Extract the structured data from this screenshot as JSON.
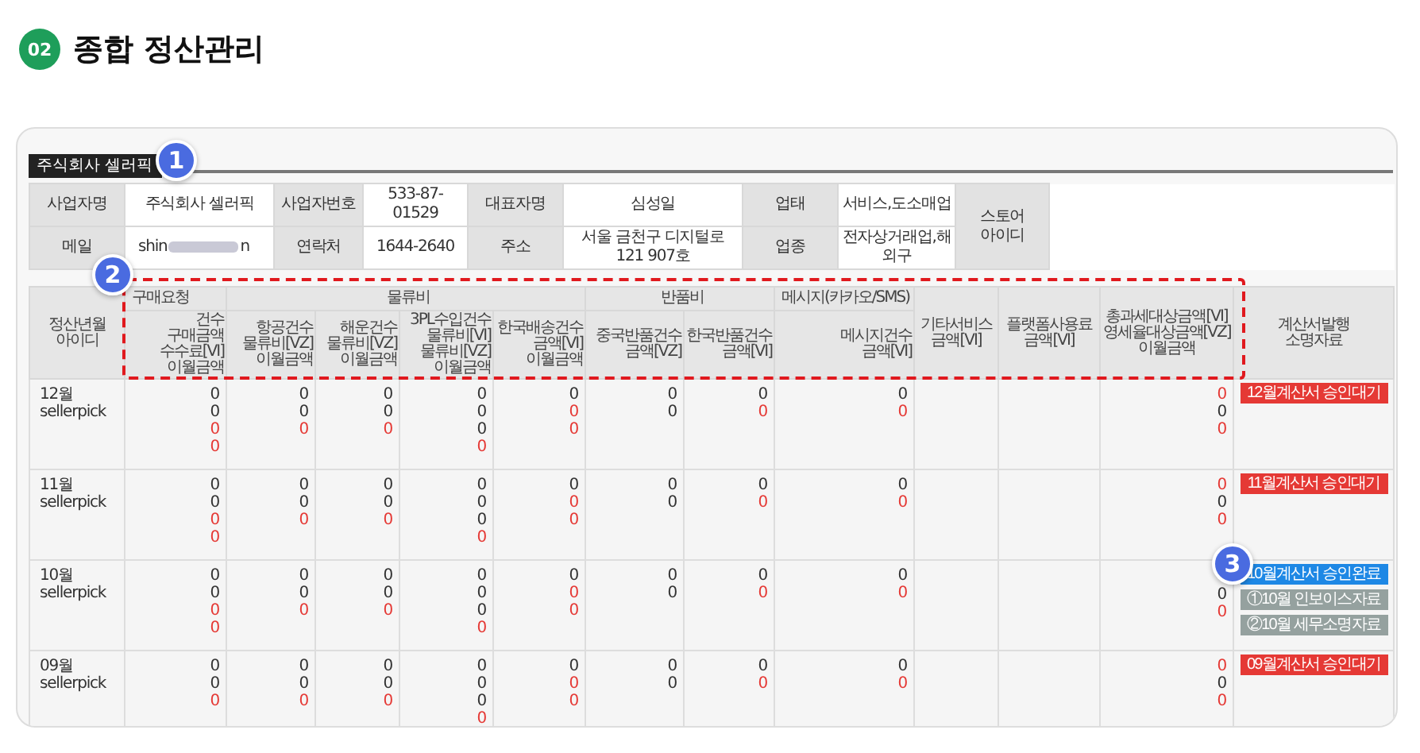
{
  "heading": {
    "number": "02",
    "title": "종합 정산관리"
  },
  "company_tab": "주식회사 셀러픽",
  "info": {
    "row1": [
      {
        "kind": "label",
        "text": "사업자명"
      },
      {
        "kind": "value",
        "text": "주식회사 셀러픽"
      },
      {
        "kind": "label",
        "text": "사업자번호"
      },
      {
        "kind": "value",
        "text": "533-87-01529"
      },
      {
        "kind": "label",
        "text": "대표자명"
      },
      {
        "kind": "value",
        "text": "심성일"
      },
      {
        "kind": "label",
        "text": "업태"
      },
      {
        "kind": "value",
        "text": "서비스,도소매업"
      }
    ],
    "row2": [
      {
        "kind": "label",
        "text": "메일"
      },
      {
        "kind": "redacted",
        "prefix": "shin",
        "suffix": "n"
      },
      {
        "kind": "label",
        "text": "연락처"
      },
      {
        "kind": "value",
        "text": "1644-2640"
      },
      {
        "kind": "label",
        "text": "주소"
      },
      {
        "kind": "value",
        "text": "서울 금천구 디지털로 121 907호"
      },
      {
        "kind": "label",
        "text": "업종"
      },
      {
        "kind": "value",
        "text": "전자상거래업,해외구"
      }
    ],
    "store_label": "스토어\n아이디"
  },
  "headers": [
    {
      "kind": "rowhead",
      "text": "정산년월\n아이디"
    },
    {
      "kind": "group",
      "text": "구매요청",
      "subs": [
        "건수\n구매금액\n수수료[VI]\n이월금액"
      ]
    },
    {
      "kind": "group",
      "text": "물류비",
      "subs": [
        "항공건수\n물류비[VZ]\n이월금액",
        "해운건수\n물류비[VZ]\n이월금액",
        "3PL수입건수\n물류비[VI]\n물류비[VZ]\n이월금액",
        "한국배송건수\n금액[VI]\n이월금액"
      ]
    },
    {
      "kind": "group",
      "text": "반품비",
      "subs": [
        "중국반품건수\n금액[VZ]",
        "한국반품건수\n금액[VI]"
      ]
    },
    {
      "kind": "group",
      "text": "메시지(카카오/SMS)",
      "subs": [
        "메시지건수\n금액[VI]"
      ]
    },
    {
      "kind": "single",
      "text": "기타서비스\n금액[VI]"
    },
    {
      "kind": "single",
      "text": "플랫폼사용료\n금액[VI]"
    },
    {
      "kind": "single",
      "text": "총과세대상금액[VI]\n영세율대상금액[VZ]\n이월금액"
    },
    {
      "kind": "single",
      "text": "계산서발행\n소명자료"
    }
  ],
  "rows": [
    {
      "month": "12월",
      "id": "sellerpick",
      "cells": [
        {
          "kind": "values",
          "lines": [
            {
              "text": "0",
              "emphasized": false
            },
            {
              "text": "0",
              "emphasized": false
            },
            {
              "text": "0",
              "emphasized": true
            },
            {
              "text": "0",
              "emphasized": true
            }
          ]
        },
        {
          "kind": "values",
          "lines": [
            {
              "text": "0",
              "emphasized": false
            },
            {
              "text": "0",
              "emphasized": false
            },
            {
              "text": "0",
              "emphasized": true
            }
          ]
        },
        {
          "kind": "values",
          "lines": [
            {
              "text": "0",
              "emphasized": false
            },
            {
              "text": "0",
              "emphasized": false
            },
            {
              "text": "0",
              "emphasized": true
            }
          ]
        },
        {
          "kind": "values",
          "lines": [
            {
              "text": "0",
              "emphasized": false
            },
            {
              "text": "0",
              "emphasized": false
            },
            {
              "text": "0",
              "emphasized": false
            },
            {
              "text": "0",
              "emphasized": true
            }
          ]
        },
        {
          "kind": "values",
          "lines": [
            {
              "text": "0",
              "emphasized": false
            },
            {
              "text": "0",
              "emphasized": true
            },
            {
              "text": "0",
              "emphasized": true
            }
          ]
        },
        {
          "kind": "values",
          "lines": [
            {
              "text": "0",
              "emphasized": false
            },
            {
              "text": "0",
              "emphasized": false
            }
          ]
        },
        {
          "kind": "values",
          "lines": [
            {
              "text": "0",
              "emphasized": false
            },
            {
              "text": "0",
              "emphasized": true
            }
          ]
        },
        {
          "kind": "values",
          "lines": [
            {
              "text": "0",
              "emphasized": false
            },
            {
              "text": "0",
              "emphasized": true
            }
          ]
        },
        {
          "kind": "blank"
        },
        {
          "kind": "blank"
        },
        {
          "kind": "values",
          "lines": [
            {
              "text": "0",
              "emphasized": true
            },
            {
              "text": "0",
              "emphasized": false
            },
            {
              "text": "0",
              "emphasized": true
            }
          ]
        }
      ],
      "buttons": [
        {
          "kind": "pending",
          "label": "12월계산서 승인대기"
        }
      ]
    },
    {
      "month": "11월",
      "id": "sellerpick",
      "cells": [
        {
          "kind": "values",
          "lines": [
            {
              "text": "0",
              "emphasized": false
            },
            {
              "text": "0",
              "emphasized": false
            },
            {
              "text": "0",
              "emphasized": true
            },
            {
              "text": "0",
              "emphasized": true
            }
          ]
        },
        {
          "kind": "values",
          "lines": [
            {
              "text": "0",
              "emphasized": false
            },
            {
              "text": "0",
              "emphasized": false
            },
            {
              "text": "0",
              "emphasized": true
            }
          ]
        },
        {
          "kind": "values",
          "lines": [
            {
              "text": "0",
              "emphasized": false
            },
            {
              "text": "0",
              "emphasized": false
            },
            {
              "text": "0",
              "emphasized": true
            }
          ]
        },
        {
          "kind": "values",
          "lines": [
            {
              "text": "0",
              "emphasized": false
            },
            {
              "text": "0",
              "emphasized": false
            },
            {
              "text": "0",
              "emphasized": false
            },
            {
              "text": "0",
              "emphasized": true
            }
          ]
        },
        {
          "kind": "values",
          "lines": [
            {
              "text": "0",
              "emphasized": false
            },
            {
              "text": "0",
              "emphasized": true
            },
            {
              "text": "0",
              "emphasized": true
            }
          ]
        },
        {
          "kind": "values",
          "lines": [
            {
              "text": "0",
              "emphasized": false
            },
            {
              "text": "0",
              "emphasized": false
            }
          ]
        },
        {
          "kind": "values",
          "lines": [
            {
              "text": "0",
              "emphasized": false
            },
            {
              "text": "0",
              "emphasized": true
            }
          ]
        },
        {
          "kind": "values",
          "lines": [
            {
              "text": "0",
              "emphasized": false
            },
            {
              "text": "0",
              "emphasized": true
            }
          ]
        },
        {
          "kind": "blank"
        },
        {
          "kind": "blank"
        },
        {
          "kind": "values",
          "lines": [
            {
              "text": "0",
              "emphasized": true
            },
            {
              "text": "0",
              "emphasized": false
            },
            {
              "text": "0",
              "emphasized": true
            }
          ]
        }
      ],
      "buttons": [
        {
          "kind": "pending",
          "label": "11월계산서 승인대기"
        }
      ]
    },
    {
      "month": "10월",
      "id": "sellerpick",
      "cells": [
        {
          "kind": "values",
          "lines": [
            {
              "text": "0",
              "emphasized": false
            },
            {
              "text": "0",
              "emphasized": false
            },
            {
              "text": "0",
              "emphasized": true
            },
            {
              "text": "0",
              "emphasized": true
            }
          ]
        },
        {
          "kind": "values",
          "lines": [
            {
              "text": "0",
              "emphasized": false
            },
            {
              "text": "0",
              "emphasized": false
            },
            {
              "text": "0",
              "emphasized": true
            }
          ]
        },
        {
          "kind": "values",
          "lines": [
            {
              "text": "0",
              "emphasized": false
            },
            {
              "text": "0",
              "emphasized": false
            },
            {
              "text": "0",
              "emphasized": true
            }
          ]
        },
        {
          "kind": "values",
          "lines": [
            {
              "text": "0",
              "emphasized": false
            },
            {
              "text": "0",
              "emphasized": false
            },
            {
              "text": "0",
              "emphasized": false
            },
            {
              "text": "0",
              "emphasized": true
            }
          ]
        },
        {
          "kind": "values",
          "lines": [
            {
              "text": "0",
              "emphasized": false
            },
            {
              "text": "0",
              "emphasized": true
            },
            {
              "text": "0",
              "emphasized": true
            }
          ]
        },
        {
          "kind": "values",
          "lines": [
            {
              "text": "0",
              "emphasized": false
            },
            {
              "text": "0",
              "emphasized": false
            }
          ]
        },
        {
          "kind": "values",
          "lines": [
            {
              "text": "0",
              "emphasized": false
            },
            {
              "text": "0",
              "emphasized": true
            }
          ]
        },
        {
          "kind": "values",
          "lines": [
            {
              "text": "0",
              "emphasized": false
            },
            {
              "text": "0",
              "emphasized": true
            }
          ]
        },
        {
          "kind": "blank"
        },
        {
          "kind": "blank"
        },
        {
          "kind": "values_below",
          "lines": [
            {
              "text": "0",
              "emphasized": false
            },
            {
              "text": "0",
              "emphasized": true
            }
          ]
        }
      ],
      "buttons": [
        {
          "kind": "approved",
          "label": "10월계산서 승인완료"
        },
        {
          "kind": "document",
          "label": "①10월 인보이스자료"
        },
        {
          "kind": "document",
          "label": "②10월 세무소명자료"
        }
      ]
    },
    {
      "month": "09월",
      "id": "sellerpick",
      "cells": [
        {
          "kind": "values",
          "lines": [
            {
              "text": "0",
              "emphasized": false
            },
            {
              "text": "0",
              "emphasized": false
            },
            {
              "text": "0",
              "emphasized": true
            }
          ]
        },
        {
          "kind": "values",
          "lines": [
            {
              "text": "0",
              "emphasized": false
            },
            {
              "text": "0",
              "emphasized": false
            },
            {
              "text": "0",
              "emphasized": true
            }
          ]
        },
        {
          "kind": "values",
          "lines": [
            {
              "text": "0",
              "emphasized": false
            },
            {
              "text": "0",
              "emphasized": false
            },
            {
              "text": "0",
              "emphasized": true
            }
          ]
        },
        {
          "kind": "values",
          "lines": [
            {
              "text": "0",
              "emphasized": false
            },
            {
              "text": "0",
              "emphasized": false
            },
            {
              "text": "0",
              "emphasized": false
            },
            {
              "text": "0",
              "emphasized": true
            }
          ]
        },
        {
          "kind": "values",
          "lines": [
            {
              "text": "0",
              "emphasized": false
            },
            {
              "text": "0",
              "emphasized": true
            },
            {
              "text": "0",
              "emphasized": true
            }
          ]
        },
        {
          "kind": "values",
          "lines": [
            {
              "text": "0",
              "emphasized": false
            },
            {
              "text": "0",
              "emphasized": false
            }
          ]
        },
        {
          "kind": "values",
          "lines": [
            {
              "text": "0",
              "emphasized": false
            },
            {
              "text": "0",
              "emphasized": true
            }
          ]
        },
        {
          "kind": "values",
          "lines": [
            {
              "text": "0",
              "emphasized": false
            },
            {
              "text": "0",
              "emphasized": true
            }
          ]
        },
        {
          "kind": "blank"
        },
        {
          "kind": "blank"
        },
        {
          "kind": "values",
          "lines": [
            {
              "text": "0",
              "emphasized": true
            },
            {
              "text": "0",
              "emphasized": false
            },
            {
              "text": "0",
              "emphasized": true
            }
          ]
        }
      ],
      "buttons": [
        {
          "kind": "pending",
          "label": "09월계산서 승인대기"
        }
      ]
    }
  ],
  "callouts": [
    {
      "label": "1"
    },
    {
      "label": "2"
    },
    {
      "label": "3"
    }
  ]
}
